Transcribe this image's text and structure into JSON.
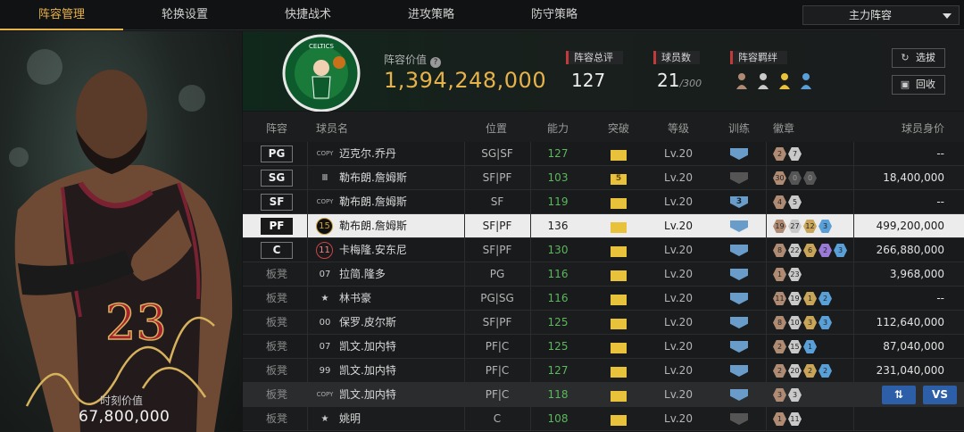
{
  "nav": {
    "tabs": [
      "阵容管理",
      "轮换设置",
      "快捷战术",
      "进攻策略",
      "防守策略"
    ],
    "active_tab": 0,
    "lineup_select": "主力阵容"
  },
  "featured": {
    "value_label": "时刻价值",
    "value": "67,800,000",
    "jersey_number": "23"
  },
  "summary": {
    "value_label": "阵容价值",
    "value": "1,394,248,000",
    "rating_label": "阵容总评",
    "rating": "127",
    "count_label": "球员数",
    "count": "21",
    "count_max": "/300",
    "bond_label": "阵容羁绊",
    "btn_select": "选拔",
    "btn_recycle": "回收"
  },
  "table": {
    "headers": [
      "阵容",
      "球员名",
      "位置",
      "能力",
      "突破",
      "等级",
      "训练",
      "徽章",
      "球员身价"
    ],
    "rows": [
      {
        "slot": "PG",
        "tag": "COPY",
        "tag_type": "copy",
        "name": "迈克尔.乔丹",
        "pos": "SG|SF",
        "ability": "127",
        "break": "",
        "level": "Lv.20",
        "train": "",
        "medals": [
          [
            "b",
            "2"
          ],
          [
            "s",
            "7"
          ]
        ],
        "salary": "--"
      },
      {
        "slot": "SG",
        "tag": "Ⅲ",
        "tag_type": "plain",
        "name": "勒布朗.詹姆斯",
        "pos": "SF|PF",
        "ability": "103",
        "break": "5",
        "level": "Lv.20",
        "train": "dim",
        "medals": [
          [
            "b",
            "30"
          ],
          [
            "d",
            "0"
          ],
          [
            "d",
            "0"
          ]
        ],
        "salary": "18,400,000"
      },
      {
        "slot": "SF",
        "tag": "COPY",
        "tag_type": "copy",
        "name": "勒布朗.詹姆斯",
        "pos": "SF",
        "ability": "119",
        "break": "",
        "level": "Lv.20",
        "train": "3",
        "medals": [
          [
            "b",
            "4"
          ],
          [
            "s",
            "5"
          ]
        ],
        "salary": "--"
      },
      {
        "slot": "PF",
        "tag": "15",
        "tag_type": "gold",
        "name": "勒布朗.詹姆斯",
        "pos": "SF|PF",
        "ability": "136",
        "break": "",
        "level": "Lv.20",
        "train": "",
        "medals": [
          [
            "b",
            "19"
          ],
          [
            "s",
            "27"
          ],
          [
            "g",
            "12"
          ],
          [
            "u",
            "3"
          ]
        ],
        "salary": "499,200,000",
        "selected": true
      },
      {
        "slot": "C",
        "tag": "11",
        "tag_type": "circ",
        "name": "卡梅隆.安东尼",
        "pos": "SF|PF",
        "ability": "130",
        "break": "",
        "level": "Lv.20",
        "train": "",
        "medals": [
          [
            "b",
            "8"
          ],
          [
            "s",
            "22"
          ],
          [
            "g",
            "6"
          ],
          [
            "p",
            "2"
          ],
          [
            "u",
            "3"
          ]
        ],
        "salary": "266,880,000"
      },
      {
        "slot": "板凳",
        "tag": "07",
        "tag_type": "plain",
        "name": "拉简.隆多",
        "pos": "PG",
        "ability": "116",
        "break": "",
        "level": "Lv.20",
        "train": "",
        "medals": [
          [
            "b",
            "1"
          ],
          [
            "s",
            "23"
          ]
        ],
        "salary": "3,968,000"
      },
      {
        "slot": "板凳",
        "tag": "★",
        "tag_type": "plain",
        "name": "林书豪",
        "pos": "PG|SG",
        "ability": "116",
        "break": "",
        "level": "Lv.20",
        "train": "",
        "medals": [
          [
            "b",
            "11"
          ],
          [
            "s",
            "19"
          ],
          [
            "g",
            "1"
          ],
          [
            "u",
            "2"
          ]
        ],
        "salary": "--"
      },
      {
        "slot": "板凳",
        "tag": "00",
        "tag_type": "plain",
        "name": "保罗.皮尔斯",
        "pos": "SF|PF",
        "ability": "125",
        "break": "",
        "level": "Lv.20",
        "train": "",
        "medals": [
          [
            "b",
            "8"
          ],
          [
            "s",
            "10"
          ],
          [
            "g",
            "3"
          ],
          [
            "u",
            "3"
          ]
        ],
        "salary": "112,640,000"
      },
      {
        "slot": "板凳",
        "tag": "07",
        "tag_type": "plain",
        "name": "凯文.加内特",
        "pos": "PF|C",
        "ability": "125",
        "break": "",
        "level": "Lv.20",
        "train": "",
        "medals": [
          [
            "b",
            "2"
          ],
          [
            "s",
            "15"
          ],
          [
            "u",
            "1"
          ]
        ],
        "salary": "87,040,000"
      },
      {
        "slot": "板凳",
        "tag": "99",
        "tag_type": "plain",
        "name": "凯文.加内特",
        "pos": "PF|C",
        "ability": "127",
        "break": "",
        "level": "Lv.20",
        "train": "",
        "medals": [
          [
            "b",
            "2"
          ],
          [
            "s",
            "20"
          ],
          [
            "g",
            "2"
          ],
          [
            "u",
            "2"
          ]
        ],
        "salary": "231,040,000"
      },
      {
        "slot": "板凳",
        "tag": "COPY",
        "tag_type": "copy",
        "name": "凯文.加内特",
        "pos": "PF|C",
        "ability": "118",
        "break": "",
        "level": "Lv.20",
        "train": "",
        "medals": [
          [
            "b",
            "3"
          ],
          [
            "s",
            "3"
          ]
        ],
        "salary": "",
        "highlight": true,
        "swap": "⇅",
        "vs": "VS"
      },
      {
        "slot": "板凳",
        "tag": "★",
        "tag_type": "plain",
        "name": "姚明",
        "pos": "C",
        "ability": "108",
        "break": "",
        "level": "Lv.20",
        "train": "dim",
        "medals": [
          [
            "b",
            "1"
          ],
          [
            "s",
            "11"
          ]
        ],
        "salary": ""
      }
    ]
  },
  "colors": {
    "accent": "#e6b24a",
    "ability_green": "#5cb85c",
    "vs_blue": "#2d5fa8",
    "stat_marker_red": "#c23a3a"
  },
  "icons": [
    "help-icon",
    "refresh-icon",
    "recycle-icon",
    "swap-icon",
    "crown-icon",
    "shield-icon",
    "medal-icon",
    "dropdown-caret-icon",
    "team-logo-icon",
    "bond-icon"
  ]
}
